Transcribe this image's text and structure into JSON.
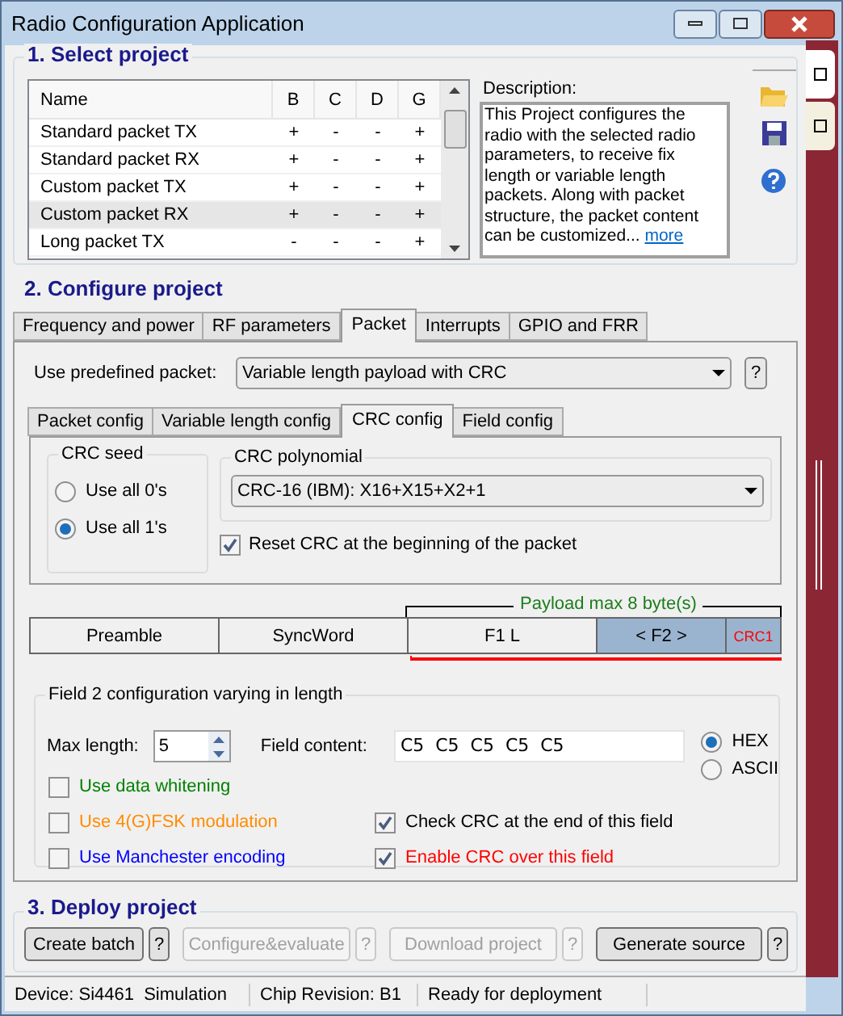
{
  "window": {
    "title": "Radio Configuration Application"
  },
  "select_project": {
    "title": "1. Select project",
    "table": {
      "columns": [
        "Name",
        "B",
        "C",
        "D",
        "G"
      ],
      "rows": [
        {
          "cells": [
            "Standard packet TX",
            "+",
            "-",
            "-",
            "+"
          ],
          "selected": false
        },
        {
          "cells": [
            "Standard packet RX",
            "+",
            "-",
            "-",
            "+"
          ],
          "selected": false
        },
        {
          "cells": [
            "Custom packet TX",
            "+",
            "-",
            "-",
            "+"
          ],
          "selected": false
        },
        {
          "cells": [
            "Custom packet RX",
            "+",
            "-",
            "-",
            "+"
          ],
          "selected": true
        },
        {
          "cells": [
            "Long packet TX",
            "-",
            "-",
            "-",
            "+"
          ],
          "selected": false
        }
      ]
    },
    "description_label": "Description:",
    "description": "This Project configures the radio with the selected radio parameters, to receive fix length or variable length packets. Along with packet structure, the packet content can be customized...",
    "more_link": "more"
  },
  "configure_project": {
    "title": "2. Configure project",
    "tabs": [
      {
        "label": "Frequency and power",
        "selected": false
      },
      {
        "label": "RF parameters",
        "selected": false
      },
      {
        "label": "Packet",
        "selected": true
      },
      {
        "label": "Interrupts",
        "selected": false
      },
      {
        "label": "GPIO and FRR",
        "selected": false
      }
    ],
    "predefined_label": "Use predefined packet:",
    "predefined_value": "Variable length payload with CRC",
    "help": "?",
    "subtabs": [
      {
        "label": "Packet config",
        "selected": false
      },
      {
        "label": "Variable length config",
        "selected": false
      },
      {
        "label": "CRC config",
        "selected": true
      },
      {
        "label": "Field config",
        "selected": false
      }
    ],
    "crc_seed": {
      "title": "CRC seed",
      "options": [
        {
          "label": "Use all 0's",
          "selected": false
        },
        {
          "label": "Use all 1's",
          "selected": true
        }
      ]
    },
    "crc_polynomial": {
      "title": "CRC polynomial",
      "value": "CRC-16 (IBM): X16+X15+X2+1"
    },
    "reset_crc": {
      "label": "Reset CRC at the beginning of the packet",
      "checked": true
    },
    "payload_label": "Payload max 8 byte(s)",
    "packet_fields": [
      {
        "label": "Preamble",
        "selected": false,
        "kind": "normal"
      },
      {
        "label": "SyncWord",
        "selected": false,
        "kind": "normal"
      },
      {
        "label": "F1 L",
        "selected": false,
        "kind": "normal"
      },
      {
        "label": "< F2 >",
        "selected": true,
        "kind": "normal"
      },
      {
        "label": "CRC1",
        "selected": true,
        "kind": "crc"
      }
    ],
    "field2": {
      "title": "Field 2 configuration varying in length",
      "max_length_label": "Max length:",
      "max_length": "5",
      "content_label": "Field content:",
      "content": "C5  C5  C5  C5  C5",
      "formats": [
        {
          "label": "HEX",
          "selected": true
        },
        {
          "label": "ASCII",
          "selected": false
        }
      ],
      "options": [
        {
          "label": "Use data whitening",
          "checked": false,
          "color": "#008000"
        },
        {
          "label": "Use 4(G)FSK modulation",
          "checked": false,
          "color": "#ff8c00"
        },
        {
          "label": "Check CRC at the end of this field",
          "checked": true,
          "color": "#000000"
        },
        {
          "label": "Use Manchester encoding",
          "checked": false,
          "color": "#0000ff"
        },
        {
          "label": "Enable CRC over this field",
          "checked": true,
          "color": "#ff0000"
        }
      ]
    }
  },
  "deploy_project": {
    "title": "3. Deploy project",
    "buttons": [
      {
        "label": "Create batch",
        "disabled": false,
        "help": "?"
      },
      {
        "label": "Configure&evaluate",
        "disabled": true,
        "help": "?"
      },
      {
        "label": "Download project",
        "disabled": true,
        "help": "?"
      },
      {
        "label": "Generate source",
        "disabled": false,
        "help": "?"
      }
    ]
  },
  "status_bar": [
    "Device: Si4461  Simulation",
    "Chip Revision: B1",
    "Ready for deployment"
  ]
}
